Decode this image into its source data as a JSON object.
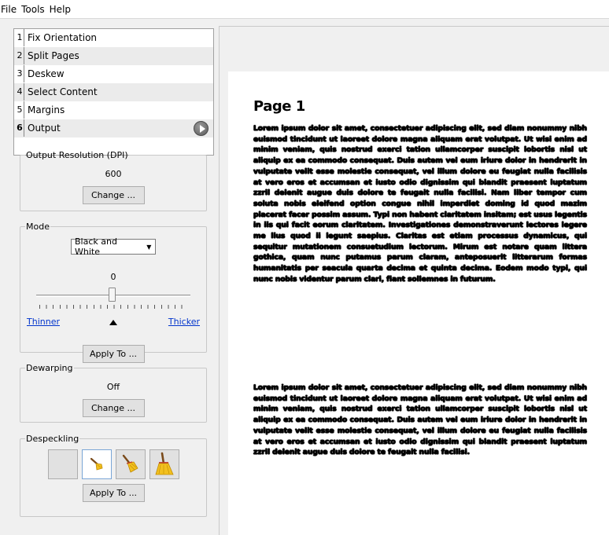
{
  "menu": [
    "File",
    "Tools",
    "Help"
  ],
  "stages": [
    {
      "num": "1",
      "label": "Fix Orientation"
    },
    {
      "num": "2",
      "label": "Split Pages"
    },
    {
      "num": "3",
      "label": "Deskew"
    },
    {
      "num": "4",
      "label": "Select Content"
    },
    {
      "num": "5",
      "label": "Margins"
    },
    {
      "num": "6",
      "label": "Output"
    }
  ],
  "output_resolution": {
    "title": "Output Resolution (DPI)",
    "value": "600",
    "change_label": "Change ..."
  },
  "mode": {
    "title": "Mode",
    "selected": "Black and White",
    "threshold_value": "0",
    "thinner_label": "Thinner",
    "thicker_label": "Thicker",
    "apply_label": "Apply To ..."
  },
  "dewarping": {
    "title": "Dewarping",
    "value": "Off",
    "change_label": "Change ..."
  },
  "despeckling": {
    "title": "Despeckling",
    "apply_label": "Apply To ...",
    "options": [
      "despeckle-off",
      "despeckle-cautious",
      "despeckle-normal",
      "despeckle-aggressive"
    ],
    "selected_index": 1
  },
  "document": {
    "heading": "Page 1",
    "paragraph_1": "Lorem ipsum dolor sit amet, consectetuer adipiscing elit, sed diam nonummy nibh euismod tincidunt ut laoreet dolore magna aliquam erat volutpat. Ut wisi enim ad minim veniam, quis nostrud exerci tation ullamcorper suscipit lobortis nisl ut aliquip ex ea commodo consequat. Duis autem vel eum iriure dolor in hendrerit in vulputate velit esse molestie consequat, vel illum dolore eu feugiat nulla facilisis at vero eros et accumsan et iusto odio dignissim qui blandit praesent luptatum zzril delenit augue duis dolore te feugait nulla facilisi. Nam liber tempor cum soluta nobis eleifend option congue nihil imperdiet doming id quod mazim placerat facer possim assum. Typi non habent claritatem insitam; est usus legentis in iis qui facit eorum claritatem. Investigationes demonstraverunt lectores legere me lius quod ii legunt saepius. Claritas est etiam processus dynamicus, qui sequitur mutationem consuetudium lectorum. Mirum est notare quam littera gothica, quam nunc putamus parum claram, anteposuerit litterarum formas humanitatis per seacula quarta decima et quinta decima. Eodem modo typi, qui nunc nobis videntur parum clari, fiant sollemnes in futurum.",
    "paragraph_2": "Lorem ipsum dolor sit amet, consectetuer adipiscing elit, sed diam nonummy nibh euismod tincidunt ut laoreet dolore magna aliquam erat volutpat. Ut wisi enim ad minim veniam, quis nostrud exerci tation ullamcorper suscipit lobortis nisl ut aliquip ex ea commodo consequat. Duis autem vel eum iriure dolor in hendrerit in vulputate velit esse molestie consequat, vel illum dolore eu feugiat nulla facilisis at vero eros et accumsan et iusto odio dignissim qui blandit praesent luptatum zzril delenit augue duis dolore te feugait nulla facilisi."
  }
}
